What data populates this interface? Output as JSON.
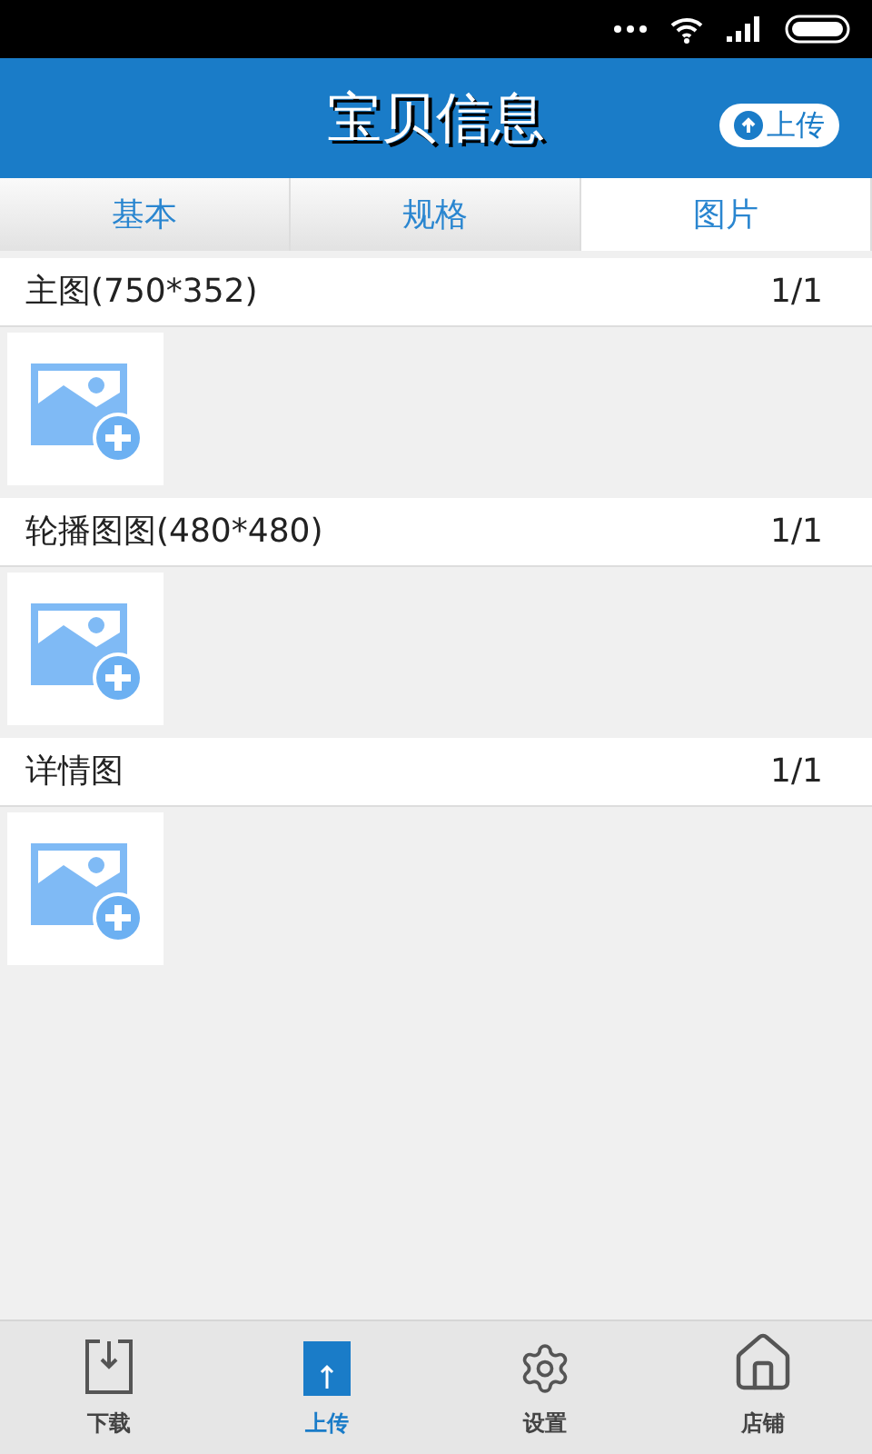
{
  "header": {
    "title": "宝贝信息",
    "upload_button": "上传"
  },
  "tabs": [
    {
      "label": "基本",
      "selected": false
    },
    {
      "label": "规格",
      "selected": false
    },
    {
      "label": "图片",
      "selected": true
    }
  ],
  "sections": [
    {
      "title": "主图(750*352)",
      "count": "1/1"
    },
    {
      "title": "轮播图图(480*480)",
      "count": "1/1"
    },
    {
      "title": "详情图",
      "count": "1/1"
    }
  ],
  "bottom_nav": [
    {
      "kind": "download",
      "label": "下载",
      "selected": false
    },
    {
      "kind": "upload",
      "label": "上传",
      "selected": true
    },
    {
      "kind": "settings",
      "label": "设置",
      "selected": false
    },
    {
      "kind": "home",
      "label": "店铺",
      "selected": false
    }
  ]
}
